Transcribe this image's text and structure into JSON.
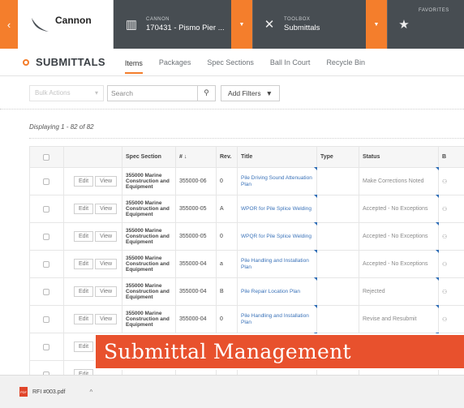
{
  "nav": {
    "brand": "Cannon",
    "project": {
      "kicker": "CANNON",
      "value": "170431 - Pismo Pier ..."
    },
    "toolbox": {
      "kicker": "TOOLBOX",
      "value": "Submittals"
    },
    "favorites": {
      "kicker": "FAVORITES"
    },
    "accent": "#f47e2c",
    "bg": "#474d52"
  },
  "tool": {
    "title": "SUBMITTALS",
    "tabs": [
      "Items",
      "Packages",
      "Spec Sections",
      "Ball In Court",
      "Recycle Bin"
    ],
    "active_tab": "Items"
  },
  "filters": {
    "bulk_placeholder": "Bulk Actions",
    "search_placeholder": "Search",
    "add_filters": "Add Filters"
  },
  "list": {
    "displaying": "Displaying 1 - 82 of 82",
    "columns": [
      "",
      "",
      "Spec Section",
      "# ↓",
      "Rev.",
      "Title",
      "Type",
      "Status",
      "B"
    ],
    "edit_label": "Edit",
    "view_label": "View",
    "rows": [
      {
        "spec": "355000 Marine Construction and Equipment",
        "num": "355000-06",
        "rev": "0",
        "title": "Pile Driving Sound Attenuation Plan",
        "type": "",
        "status": "Make Corrections Noted"
      },
      {
        "spec": "355000 Marine Construction and Equipment",
        "num": "355000-05",
        "rev": "A",
        "title": "WPOR for Pile Splice Welding",
        "type": "",
        "status": "Accepted - No Exceptions"
      },
      {
        "spec": "355000 Marine Construction and Equipment",
        "num": "355000-05",
        "rev": "0",
        "title": "WPQR for Pile Splice Welding",
        "type": "",
        "status": "Accepted - No Exceptions"
      },
      {
        "spec": "355000 Marine Construction and Equipment",
        "num": "355000-04",
        "rev": "a",
        "title": "Pile Handling and Installation Plan",
        "type": "",
        "status": "Accepted - No Exceptions"
      },
      {
        "spec": "355000 Marine Construction and Equipment",
        "num": "355000-04",
        "rev": "B",
        "title": "Pile Repair Location Plan",
        "type": "",
        "status": "Rejected"
      },
      {
        "spec": "355000 Marine Construction and Equipment",
        "num": "355000-04",
        "rev": "0",
        "title": "Pile Handling and Installation Plan",
        "type": "",
        "status": "Revise and Resubmit"
      },
      {
        "spec": "",
        "num": "",
        "rev": "",
        "title": "",
        "type": "",
        "status": ""
      },
      {
        "spec": "",
        "num": "",
        "rev": "",
        "title": "",
        "type": "",
        "status": ""
      }
    ]
  },
  "banner": {
    "text": "Submittal Management",
    "color": "#e8512d"
  },
  "download": {
    "filename": "RFI #003.pdf"
  }
}
